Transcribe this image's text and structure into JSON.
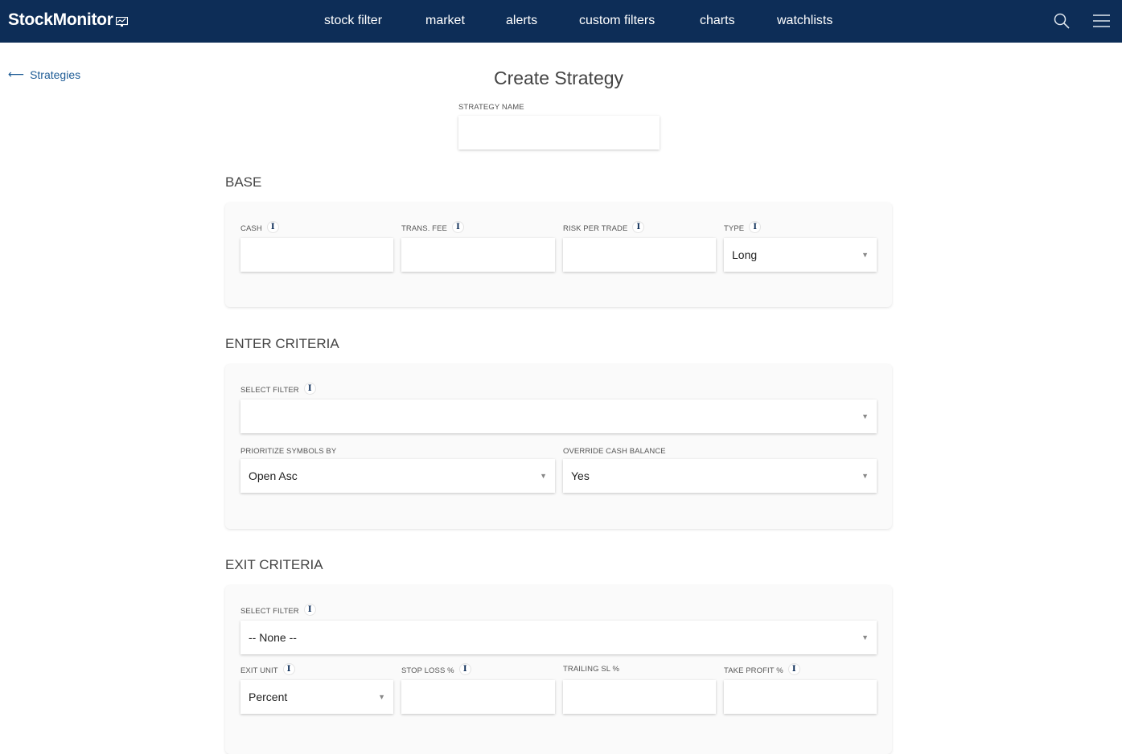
{
  "header": {
    "logo": "StockMonitor",
    "nav": [
      "stock filter",
      "market",
      "alerts",
      "custom filters",
      "charts",
      "watchlists"
    ]
  },
  "back_link": "Strategies",
  "title": "Create Strategy",
  "strategy_name": {
    "label": "STRATEGY NAME",
    "value": ""
  },
  "base": {
    "heading": "BASE",
    "cash_label": "CASH",
    "fee_label": "TRANS. FEE",
    "risk_label": "RISK PER TRADE",
    "type_label": "TYPE",
    "type_value": "Long"
  },
  "enter": {
    "heading": "ENTER CRITERIA",
    "filter_label": "SELECT FILTER",
    "filter_value": "",
    "prioritize_label": "PRIORITIZE SYMBOLS BY",
    "prioritize_value": "Open Asc",
    "override_label": "OVERRIDE CASH BALANCE",
    "override_value": "Yes"
  },
  "exit": {
    "heading": "EXIT CRITERIA",
    "filter_label": "SELECT FILTER",
    "filter_value": "-- None --",
    "unit_label": "EXIT UNIT",
    "unit_value": "Percent",
    "stop_label": "STOP LOSS %",
    "trailing_label": "TRAILING SL %",
    "profit_label": "TAKE PROFIT %"
  },
  "info_glyph": "i",
  "colors": {
    "navbar": "#0d2d57",
    "link": "#1e5c96"
  }
}
